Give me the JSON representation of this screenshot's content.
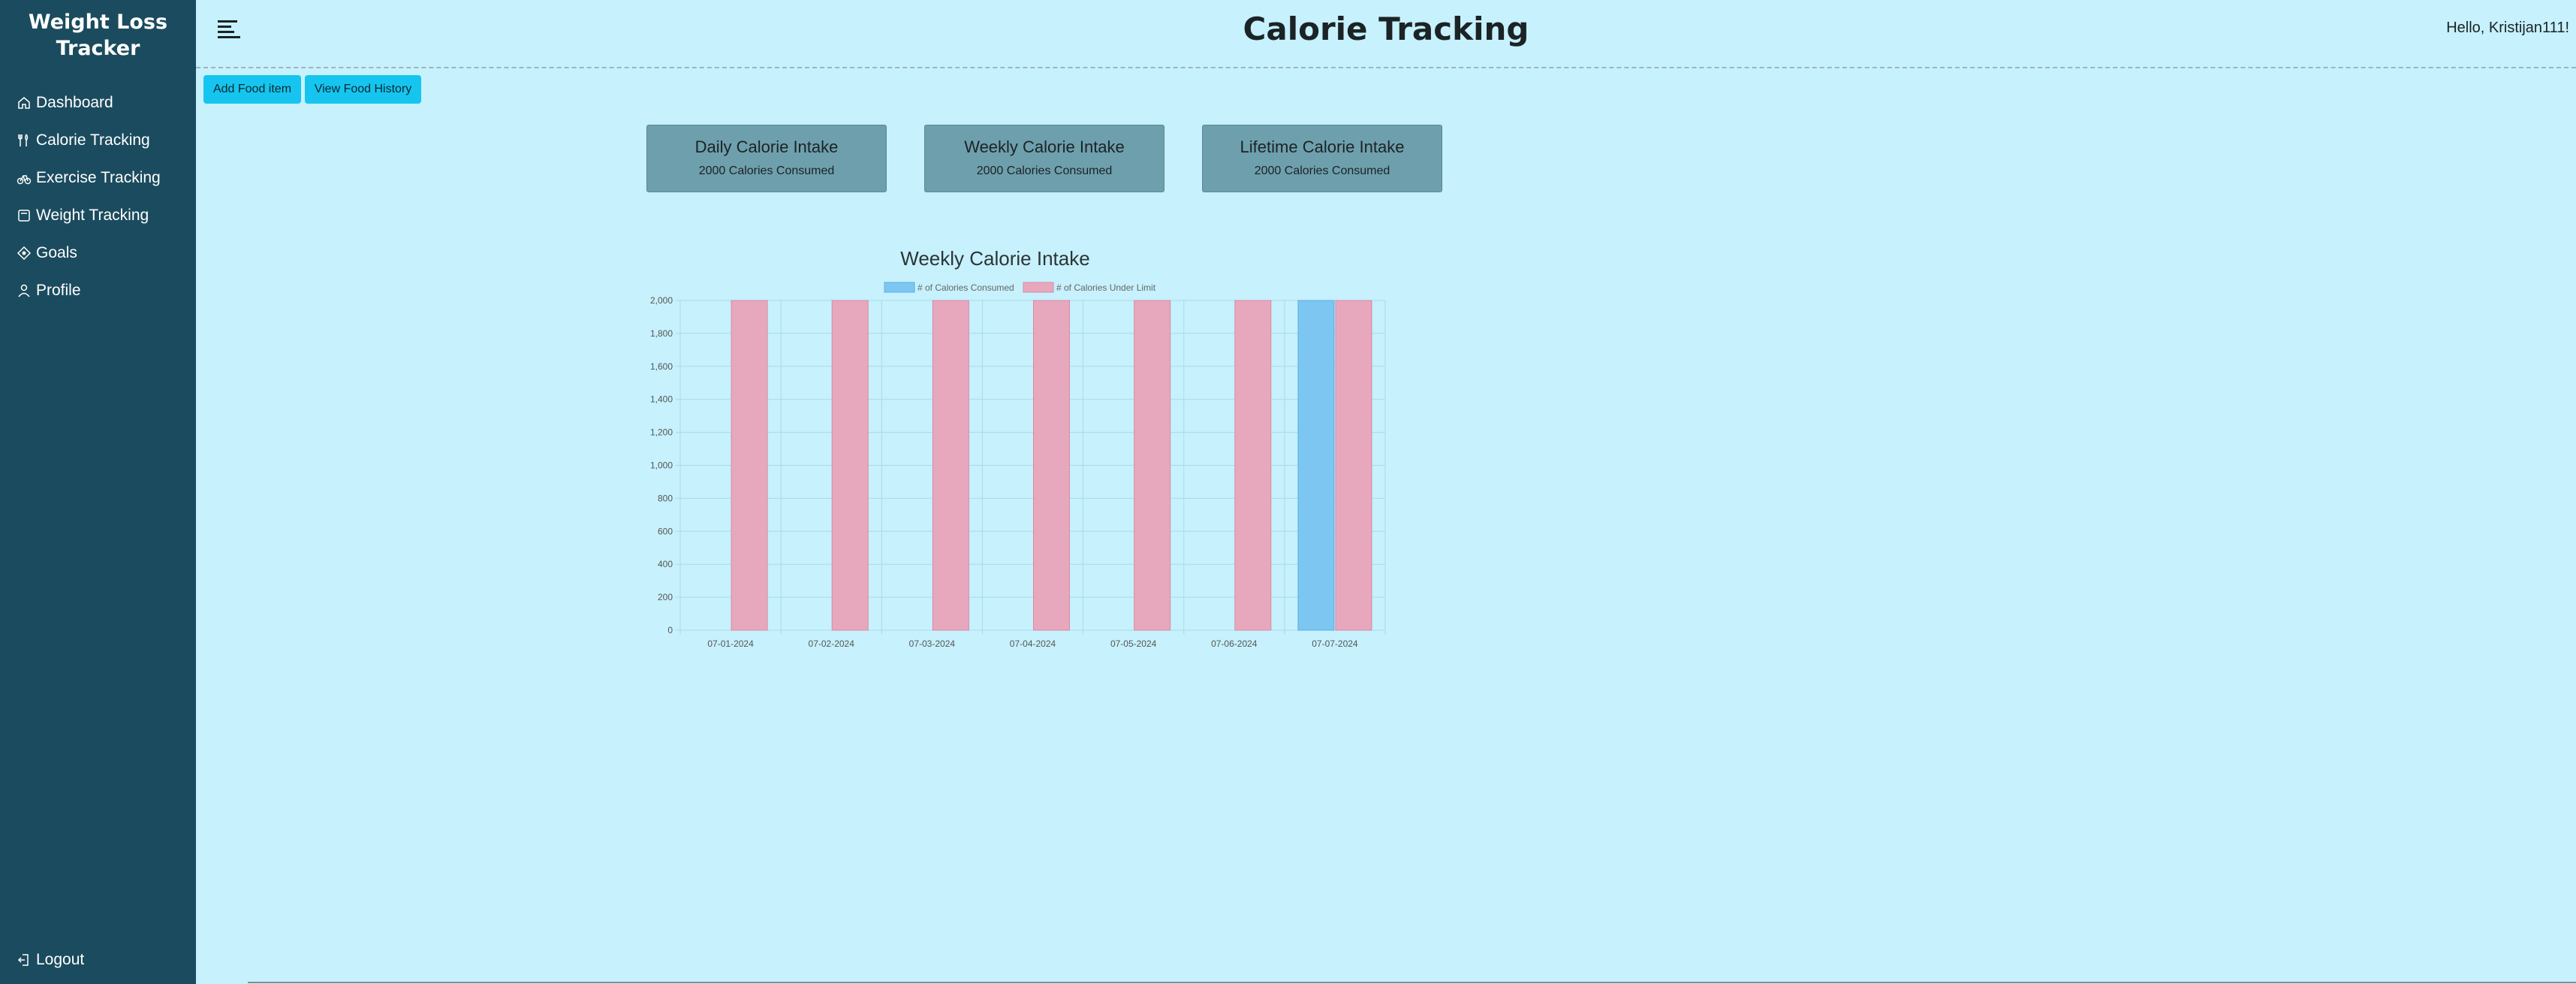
{
  "sidebar": {
    "brand": "Weight Loss Tracker",
    "items": [
      {
        "label": "Dashboard",
        "icon": "home-icon"
      },
      {
        "label": "Calorie Tracking",
        "icon": "utensils-icon"
      },
      {
        "label": "Exercise Tracking",
        "icon": "bicycle-icon"
      },
      {
        "label": "Weight Tracking",
        "icon": "scale-icon"
      },
      {
        "label": "Goals",
        "icon": "target-icon"
      },
      {
        "label": "Profile",
        "icon": "user-icon"
      }
    ],
    "logout": "Logout"
  },
  "header": {
    "title": "Calorie Tracking",
    "greeting": "Hello, Kristijan111!"
  },
  "toolbar": {
    "add_label": "Add Food item",
    "history_label": "View Food History"
  },
  "cards": [
    {
      "title": "Daily Calorie Intake",
      "value": "2000 Calories Consumed"
    },
    {
      "title": "Weekly Calorie Intake",
      "value": "2000 Calories Consumed"
    },
    {
      "title": "Lifetime Calorie Intake",
      "value": "2000 Calories Consumed"
    }
  ],
  "colors": {
    "sidebar": "#1b4b5e",
    "background": "#c6f1fd",
    "button": "#16c5ef",
    "card": "#6e9fad",
    "consumed": "#7dc6f2",
    "under_limit": "#e7a8bd"
  },
  "chart_data": {
    "type": "bar",
    "title": "Weekly Calorie Intake",
    "categories": [
      "07-01-2024",
      "07-02-2024",
      "07-03-2024",
      "07-04-2024",
      "07-05-2024",
      "07-06-2024",
      "07-07-2024"
    ],
    "series": [
      {
        "name": "# of Calories Consumed",
        "values": [
          0,
          0,
          0,
          0,
          0,
          0,
          2000
        ]
      },
      {
        "name": "# of Calories Under Limit",
        "values": [
          2000,
          2000,
          2000,
          2000,
          2000,
          2000,
          2000
        ]
      }
    ],
    "ylim": [
      0,
      2000
    ],
    "yticks": [
      "0",
      "200",
      "400",
      "600",
      "800",
      "1,000",
      "1,200",
      "1,400",
      "1,600",
      "1,800",
      "2,000"
    ],
    "grid": true,
    "legend": "top"
  }
}
